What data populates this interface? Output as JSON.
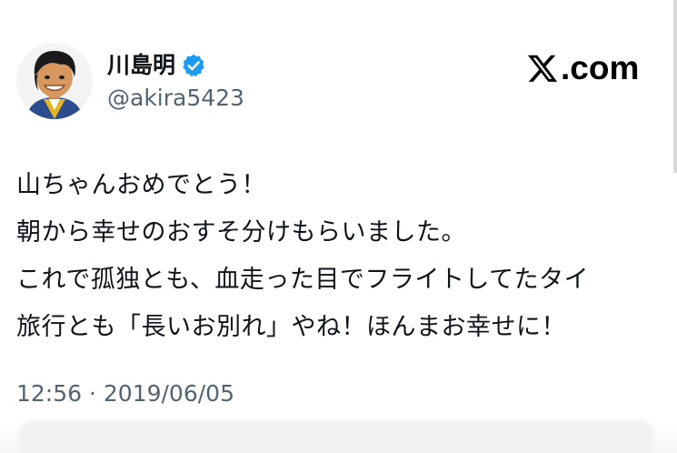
{
  "tweet": {
    "author": {
      "display_name": "川島明",
      "handle": "@akira5423",
      "verified": true,
      "avatar_icon": "caricature-avatar-icon",
      "verified_icon": "verified-badge-icon"
    },
    "brand": {
      "text": ".com",
      "icon": "x-logo-icon"
    },
    "text_lines": [
      "山ちゃんおめでとう！",
      "朝から幸せのおすそ分けもらいました。",
      "これで孤独とも、血走った目でフライトしてたタイ",
      "旅行とも「長いお別れ」やね！ほんまお幸せに！"
    ],
    "timestamp": "12:56 · 2019/06/05"
  },
  "colors": {
    "text": "#0f1419",
    "secondary_text": "#536471",
    "verified_blue": "#1d9bf0",
    "background": "#ffffff"
  }
}
